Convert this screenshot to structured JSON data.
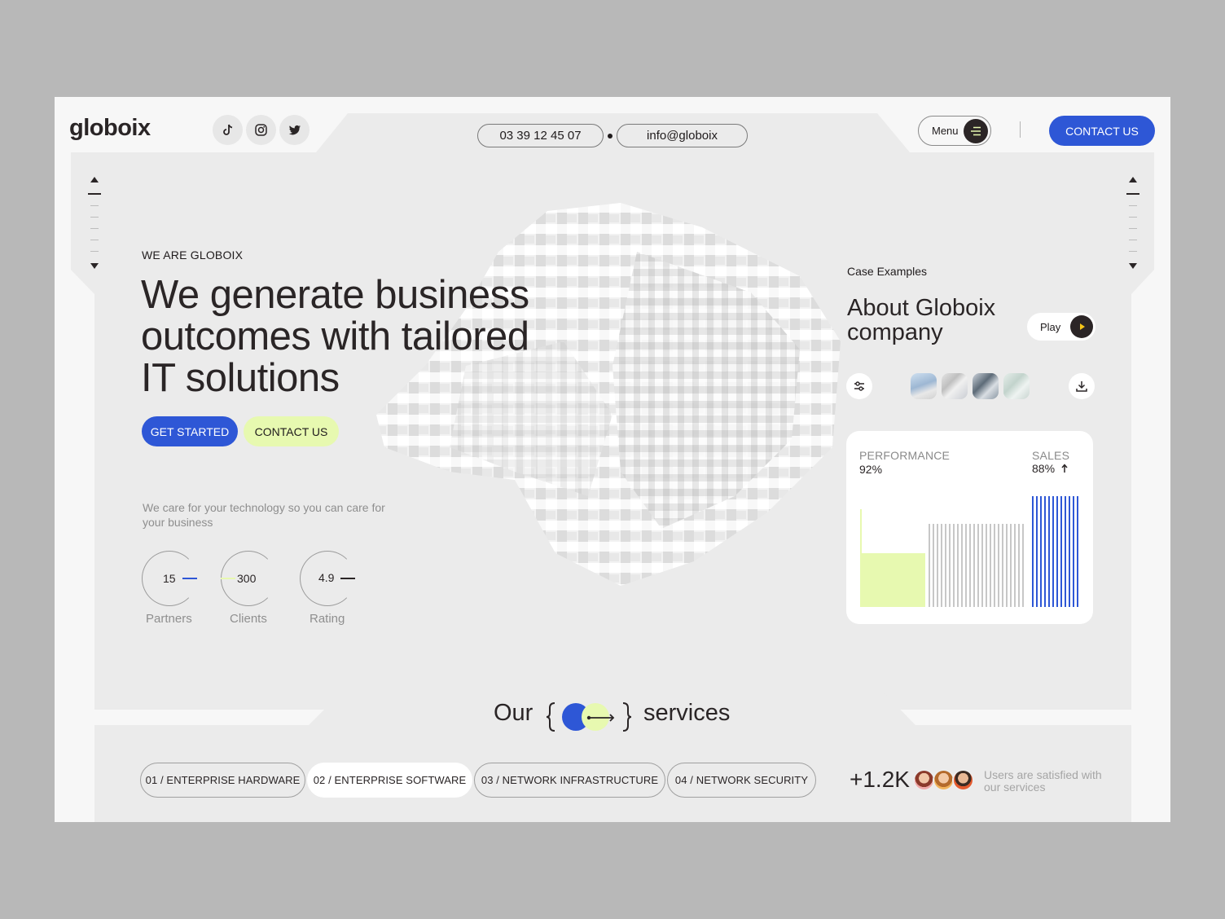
{
  "brand": {
    "logo": "globoix"
  },
  "social": [
    {
      "icon": "tiktok-icon"
    },
    {
      "icon": "instagram-icon"
    },
    {
      "icon": "twitter-icon"
    }
  ],
  "contact": {
    "phone": "03 39 12 45 07",
    "email": "info@globoix"
  },
  "nav": {
    "menu_label": "Menu",
    "contact_label": "CONTACT US"
  },
  "hero": {
    "eyebrow": "WE ARE GLOBOIX",
    "headline_line1": "We generate business",
    "headline_line2": "outcomes with tailored",
    "headline_line3": "IT solutions",
    "cta_primary": "GET STARTED",
    "cta_secondary": "CONTACT US",
    "subtext": "We care for your technology so you can care for your business",
    "stats": [
      {
        "value": "15",
        "label": "Partners"
      },
      {
        "value": "300",
        "label": "Clients"
      },
      {
        "value": "4.9",
        "label": "Rating"
      }
    ]
  },
  "case": {
    "eyebrow": "Case Examples",
    "title": "About Globoix company",
    "play_label": "Play"
  },
  "performance_card": {
    "left_label": "PERFORMANCE",
    "left_value": "92%",
    "right_label": "SALES",
    "right_value": "88%",
    "colors": {
      "lime": "#e7f9b0",
      "gray": "#c7c7c7",
      "blue": "#2e57d6"
    }
  },
  "services": {
    "title_left": "Our",
    "title_right": "services",
    "tabs": [
      {
        "label": "01 / ENTERPRISE HARDWARE",
        "active": false
      },
      {
        "label": "02 / ENTERPRISE SOFTWARE",
        "active": true
      },
      {
        "label": "03 / NETWORK INFRASTRUCTURE",
        "active": false
      },
      {
        "label": "04 / NETWORK SECURITY",
        "active": false
      }
    ],
    "users_count": "+1.2K",
    "users_text": "Users are satisfied with our services"
  },
  "theme": {
    "accent_blue": "#2e57d6",
    "accent_lime": "#e7f9b0",
    "dark": "#2b2526"
  }
}
